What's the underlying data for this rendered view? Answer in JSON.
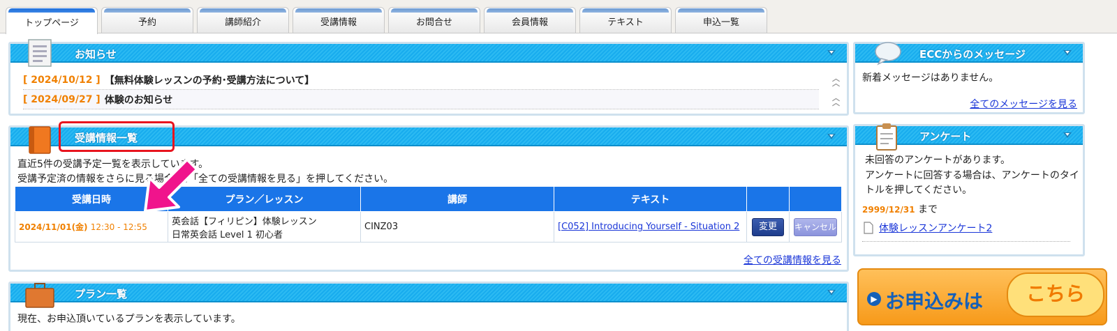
{
  "tabs": [
    {
      "label": "トップページ",
      "active": true
    },
    {
      "label": "予約"
    },
    {
      "label": "講師紹介"
    },
    {
      "label": "受講情報"
    },
    {
      "label": "お問合せ"
    },
    {
      "label": "会員情報"
    },
    {
      "label": "テキスト"
    },
    {
      "label": "申込一覧"
    }
  ],
  "news": {
    "title": "お知らせ",
    "items": [
      {
        "date": "[ 2024/10/12 ]",
        "text": "【無料体験レッスンの予約･受講方法について】"
      },
      {
        "date": "[ 2024/09/27 ]",
        "text": "体験のお知らせ"
      }
    ]
  },
  "lessons": {
    "title": "受講情報一覧",
    "intro1": "直近5件の受講予定一覧を表示しています。",
    "intro2": "受講予定済の情報をさらに見る場合は、「全ての受講情報を見る」を押してください。",
    "headers": [
      "受講日時",
      "プラン／レッスン",
      "講師",
      "テキスト",
      "",
      ""
    ],
    "row": {
      "date": "2024/11/01(金)",
      "time": "12:30 - 12:55",
      "plan1": "英会話【フィリピン】体験レッスン",
      "plan2": "日常英会話 Level 1 初心者",
      "teacher": "CINZ03",
      "text": "[C052] Introducing Yourself - Situation 2",
      "change": "変更",
      "cancel": "キャンセル"
    },
    "all_link": "全ての受講情報を見る"
  },
  "plans": {
    "title": "プラン一覧",
    "intro": "現在、お申込頂いているプランを表示しています。"
  },
  "messages": {
    "title": "ECCからのメッセージ",
    "empty": "新着メッセージはありません。",
    "all_link": "全てのメッセージを見る"
  },
  "survey": {
    "title": "アンケート",
    "line1": "未回答のアンケートがあります。",
    "line2": "アンケートに回答する場合は、アンケートのタイ",
    "line3": "トルを押してください。",
    "deadline": "2999/12/31",
    "deadline_suffix": "まで",
    "item": "体験レッスンアンケート2"
  },
  "apply_banner": {
    "text": "お申込みは",
    "bubble": "こちら"
  },
  "colors": {
    "header_blue": "#18acee",
    "table_head": "#1a75e8",
    "orange": "#f08000",
    "highlight_red": "#e8141e",
    "arrow_pink": "#f0148c"
  }
}
